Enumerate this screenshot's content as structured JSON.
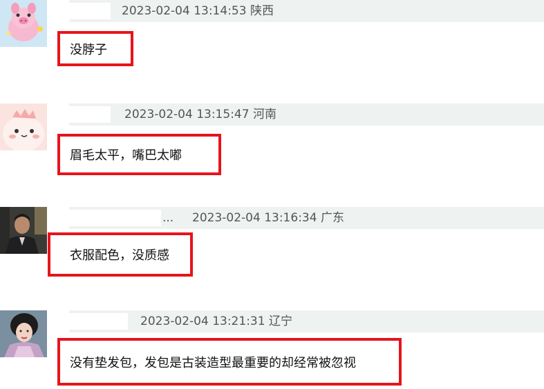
{
  "comments": [
    {
      "avatar_icon": "pink-pig-cartoon-avatar",
      "timestamp": "2023-02-04 13:14:53",
      "location": "陕西",
      "text": "没脖子",
      "highlight_color": "#e6141b"
    },
    {
      "avatar_icon": "cute-pink-dinosaur-avatar",
      "timestamp": "2023-02-04 13:15:47",
      "location": "河南",
      "text": "眉毛太平，嘴巴太嘟",
      "highlight_color": "#e6141b"
    },
    {
      "avatar_icon": "man-in-suit-photo-avatar",
      "username_truncated": "...",
      "timestamp": "2023-02-04 13:16:34",
      "location": "广东",
      "text": "衣服配色，没质感",
      "highlight_color": "#e6141b"
    },
    {
      "avatar_icon": "woman-in-costume-photo-avatar",
      "timestamp": "2023-02-04 13:21:31",
      "location": "辽宁",
      "text": "没有垫发包，发包是古装造型最重要的却经常被忽视",
      "highlight_color": "#e6141b"
    }
  ]
}
